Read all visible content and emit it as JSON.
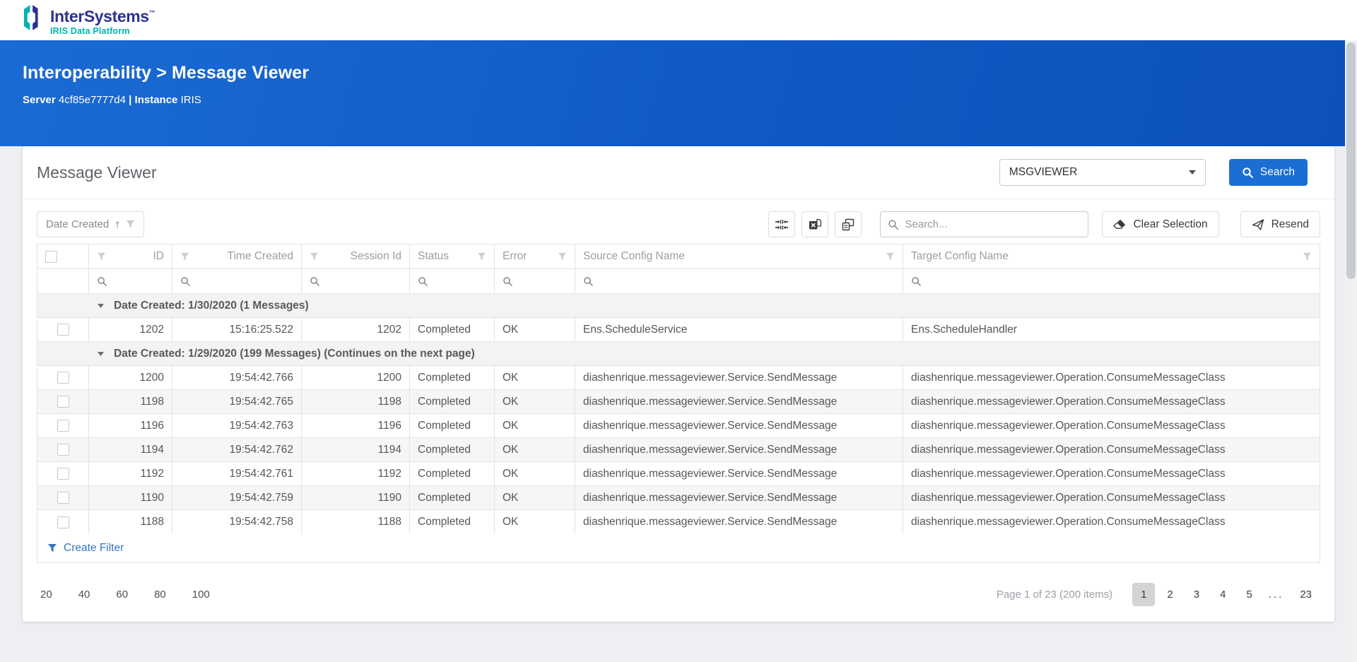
{
  "topbar": {
    "logo": {
      "brand": "InterSystems",
      "tm": "™",
      "sub": "IRIS Data Platform"
    }
  },
  "header": {
    "breadcrumb": "Interoperability > Message Viewer",
    "server_label": "Server",
    "server_value": "4cf85e7777d4",
    "separator": "|",
    "instance_label": "Instance",
    "instance_value": "IRIS"
  },
  "panel": {
    "title": "Message Viewer",
    "namespace_select": {
      "value": "MSGVIEWER"
    },
    "search_button": "Search",
    "toolbar": {
      "sort_chip": {
        "label": "Date Created",
        "direction": "↑"
      },
      "icons": [
        "collapse-all",
        "export-excel",
        "column-chooser"
      ],
      "search_placeholder": "Search...",
      "clear_selection": "Clear Selection",
      "resend": "Resend"
    },
    "grid": {
      "columns": [
        {
          "key": "select",
          "label": "",
          "type": "checkbox"
        },
        {
          "key": "id",
          "label": "ID",
          "align": "right",
          "icon": "left"
        },
        {
          "key": "time",
          "label": "Time Created",
          "align": "right",
          "icon": "left"
        },
        {
          "key": "session",
          "label": "Session Id",
          "align": "right",
          "icon": "left"
        },
        {
          "key": "status",
          "label": "Status",
          "align": "left",
          "icon": "right"
        },
        {
          "key": "error",
          "label": "Error",
          "align": "left",
          "icon": "right"
        },
        {
          "key": "source",
          "label": "Source Config Name",
          "align": "left",
          "icon": "right"
        },
        {
          "key": "target",
          "label": "Target Config Name",
          "align": "left",
          "icon": "right"
        }
      ],
      "groups": [
        {
          "label": "Date Created: 1/30/2020 (1 Messages)",
          "rows": [
            {
              "id": "1202",
              "time": "15:16:25.522",
              "session": "1202",
              "status": "Completed",
              "error": "OK",
              "source": "Ens.ScheduleService",
              "target": "Ens.ScheduleHandler"
            }
          ]
        },
        {
          "label": "Date Created: 1/29/2020 (199 Messages) (Continues on the next page)",
          "rows": [
            {
              "id": "1200",
              "time": "19:54:42.766",
              "session": "1200",
              "status": "Completed",
              "error": "OK",
              "source": "diashenrique.messageviewer.Service.SendMessage",
              "target": "diashenrique.messageviewer.Operation.ConsumeMessageClass"
            },
            {
              "id": "1198",
              "time": "19:54:42.765",
              "session": "1198",
              "status": "Completed",
              "error": "OK",
              "source": "diashenrique.messageviewer.Service.SendMessage",
              "target": "diashenrique.messageviewer.Operation.ConsumeMessageClass"
            },
            {
              "id": "1196",
              "time": "19:54:42.763",
              "session": "1196",
              "status": "Completed",
              "error": "OK",
              "source": "diashenrique.messageviewer.Service.SendMessage",
              "target": "diashenrique.messageviewer.Operation.ConsumeMessageClass"
            },
            {
              "id": "1194",
              "time": "19:54:42.762",
              "session": "1194",
              "status": "Completed",
              "error": "OK",
              "source": "diashenrique.messageviewer.Service.SendMessage",
              "target": "diashenrique.messageviewer.Operation.ConsumeMessageClass"
            },
            {
              "id": "1192",
              "time": "19:54:42.761",
              "session": "1192",
              "status": "Completed",
              "error": "OK",
              "source": "diashenrique.messageviewer.Service.SendMessage",
              "target": "diashenrique.messageviewer.Operation.ConsumeMessageClass"
            },
            {
              "id": "1190",
              "time": "19:54:42.759",
              "session": "1190",
              "status": "Completed",
              "error": "OK",
              "source": "diashenrique.messageviewer.Service.SendMessage",
              "target": "diashenrique.messageviewer.Operation.ConsumeMessageClass"
            },
            {
              "id": "1188",
              "time": "19:54:42.758",
              "session": "1188",
              "status": "Completed",
              "error": "OK",
              "source": "diashenrique.messageviewer.Service.SendMessage",
              "target": "diashenrique.messageviewer.Operation.ConsumeMessageClass"
            }
          ]
        }
      ],
      "create_filter": "Create Filter"
    },
    "pager": {
      "page_sizes": [
        "20",
        "40",
        "60",
        "80",
        "100"
      ],
      "info": "Page 1 of 23 (200 items)",
      "pages": [
        "1",
        "2",
        "3",
        "4",
        "5",
        "...",
        "23"
      ],
      "active_page": "1"
    }
  },
  "colors": {
    "hero_blue": "#1160c9",
    "primary_button": "#1b6ed3",
    "brand_navy": "#2e3192",
    "brand_teal": "#00b2af",
    "link_blue": "#3377bb"
  }
}
